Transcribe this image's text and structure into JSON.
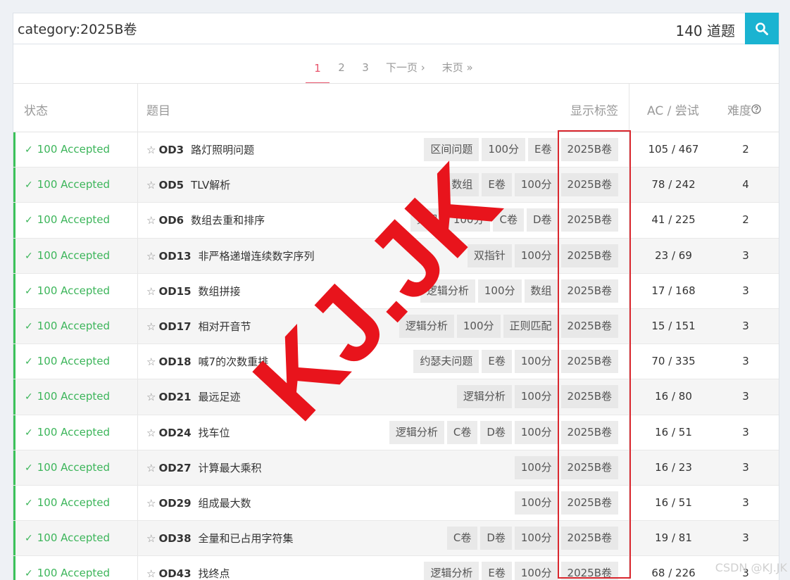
{
  "search": {
    "value": "category:2025B卷",
    "count": "140 道题"
  },
  "pagination": {
    "pages": [
      "1",
      "2",
      "3"
    ],
    "next": "下一页 ›",
    "last": "末页 »",
    "current": "1"
  },
  "table": {
    "headers": {
      "status": "状态",
      "title": "题目",
      "tags": "显示标签",
      "ac": "AC / 尝试",
      "difficulty": "难度"
    },
    "rows": [
      {
        "status": "100 Accepted",
        "code": "OD3",
        "name": "路灯照明问题",
        "tags": [
          "区间问题",
          "100分",
          "E卷",
          "2025B卷"
        ],
        "ac": "105 / 467",
        "difficulty": "2"
      },
      {
        "status": "100 Accepted",
        "code": "OD5",
        "name": "TLV解析",
        "tags": [
          "数组",
          "E卷",
          "100分",
          "2025B卷"
        ],
        "ac": "78 / 242",
        "difficulty": "4"
      },
      {
        "status": "100 Accepted",
        "code": "OD6",
        "name": "数组去重和排序",
        "tags": [
          "数组",
          "100分",
          "C卷",
          "D卷",
          "2025B卷"
        ],
        "ac": "41 / 225",
        "difficulty": "2"
      },
      {
        "status": "100 Accepted",
        "code": "OD13",
        "name": "非严格递增连续数字序列",
        "tags": [
          "双指针",
          "100分",
          "2025B卷"
        ],
        "ac": "23 / 69",
        "difficulty": "3"
      },
      {
        "status": "100 Accepted",
        "code": "OD15",
        "name": "数组拼接",
        "tags": [
          "逻辑分析",
          "100分",
          "数组",
          "2025B卷"
        ],
        "ac": "17 / 168",
        "difficulty": "3"
      },
      {
        "status": "100 Accepted",
        "code": "OD17",
        "name": "相对开音节",
        "tags": [
          "逻辑分析",
          "100分",
          "正则匹配",
          "2025B卷"
        ],
        "ac": "15 / 151",
        "difficulty": "3"
      },
      {
        "status": "100 Accepted",
        "code": "OD18",
        "name": "喊7的次数重排",
        "tags": [
          "约瑟夫问题",
          "E卷",
          "100分",
          "2025B卷"
        ],
        "ac": "70 / 335",
        "difficulty": "3"
      },
      {
        "status": "100 Accepted",
        "code": "OD21",
        "name": "最远足迹",
        "tags": [
          "逻辑分析",
          "100分",
          "2025B卷"
        ],
        "ac": "16 / 80",
        "difficulty": "3"
      },
      {
        "status": "100 Accepted",
        "code": "OD24",
        "name": "找车位",
        "tags": [
          "逻辑分析",
          "C卷",
          "D卷",
          "100分",
          "2025B卷"
        ],
        "ac": "16 / 51",
        "difficulty": "3"
      },
      {
        "status": "100 Accepted",
        "code": "OD27",
        "name": "计算最大乘积",
        "tags": [
          "100分",
          "2025B卷"
        ],
        "ac": "16 / 23",
        "difficulty": "3"
      },
      {
        "status": "100 Accepted",
        "code": "OD29",
        "name": "组成最大数",
        "tags": [
          "100分",
          "2025B卷"
        ],
        "ac": "16 / 51",
        "difficulty": "3"
      },
      {
        "status": "100 Accepted",
        "code": "OD38",
        "name": "全量和已占用字符集",
        "tags": [
          "C卷",
          "D卷",
          "100分",
          "2025B卷"
        ],
        "ac": "19 / 81",
        "difficulty": "3"
      },
      {
        "status": "100 Accepted",
        "code": "OD43",
        "name": "找终点",
        "tags": [
          "逻辑分析",
          "E卷",
          "100分",
          "2025B卷"
        ],
        "ac": "68 / 226",
        "difficulty": "3"
      }
    ]
  },
  "watermark": "KJ.JK",
  "credit": "CSDN @KJ.JK",
  "colors": {
    "accent": "#1ab3d1",
    "accepted": "#3cb55a",
    "active_page": "#e8546c",
    "highlight_box": "#d9272e",
    "watermark": "#e8141c"
  },
  "icons": {
    "search": "search-icon",
    "star": "star-icon",
    "check": "check-icon",
    "help": "help-circle-icon"
  }
}
